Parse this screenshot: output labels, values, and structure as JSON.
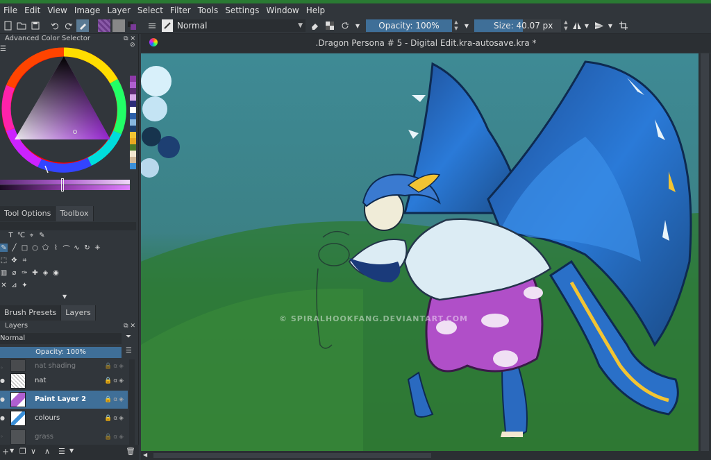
{
  "menubar": {
    "items": [
      "File",
      "Edit",
      "View",
      "Image",
      "Layer",
      "Select",
      "Filter",
      "Tools",
      "Settings",
      "Window",
      "Help"
    ]
  },
  "toolbar": {
    "blend_mode": "Normal",
    "opacity": "Opacity: 100%",
    "size": "Size: 40.07 px"
  },
  "color_selector": {
    "title": "Advanced Color Selector",
    "palette": [
      "#8e3aa8",
      "#b05fd0",
      "#5a2a72",
      "#d6a8e8",
      "#2d2d7a",
      "#ffffff",
      "#2b5fa8",
      "#88b8e0",
      "#1c3f6e",
      "#f2c433",
      "#e8a820",
      "#4b7a2a",
      "#f4e8d0",
      "#d0b898",
      "#3a8fd8"
    ]
  },
  "tool_options": {
    "tabs": [
      "Tool Options",
      "Toolbox"
    ],
    "active_tab": "Toolbox"
  },
  "layers": {
    "tabs": [
      "Brush Presets",
      "Layers"
    ],
    "active_tab": "Layers",
    "title": "Layers",
    "blend_mode": "Normal",
    "opacity": "Opacity:  100%",
    "items": [
      {
        "name": "nat shading"
      },
      {
        "name": "nat"
      },
      {
        "name": "Paint Layer 2"
      },
      {
        "name": "colours"
      },
      {
        "name": "grass"
      }
    ]
  },
  "document": {
    "title": ".Dragon Persona # 5 - Digital Edit.kra-autosave.kra *",
    "watermark": "© SPIRALHOOKFANG.DEVIANTART.COM"
  }
}
